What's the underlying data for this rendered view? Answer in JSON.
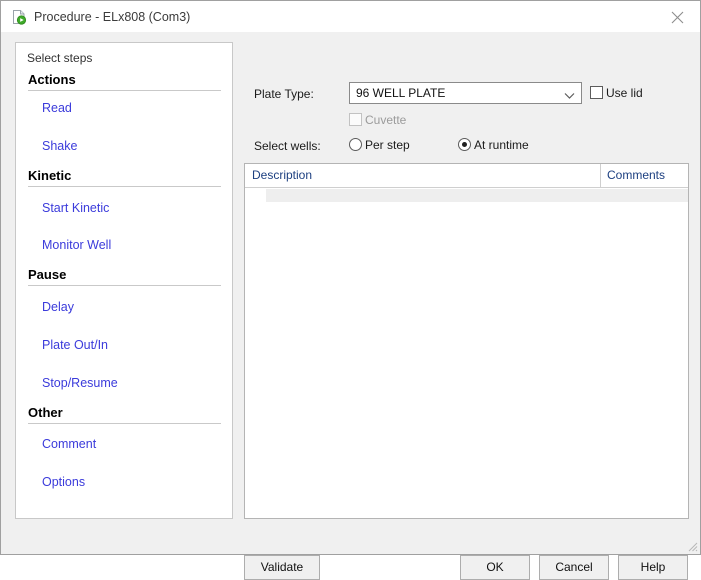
{
  "window": {
    "title": "Procedure - ELx808 (Com3)",
    "icon": "procedure-document-icon",
    "close_label": "✕"
  },
  "steps_panel": {
    "label": "Select steps",
    "groups": [
      {
        "title": "Actions",
        "items": [
          {
            "label": "Read"
          },
          {
            "label": "Shake"
          }
        ]
      },
      {
        "title": "Kinetic",
        "items": [
          {
            "label": "Start Kinetic"
          },
          {
            "label": "Monitor Well"
          }
        ]
      },
      {
        "title": "Pause",
        "items": [
          {
            "label": "Delay"
          },
          {
            "label": "Plate Out/In"
          },
          {
            "label": "Stop/Resume"
          }
        ]
      },
      {
        "title": "Other",
        "items": [
          {
            "label": "Comment"
          },
          {
            "label": "Options"
          }
        ]
      }
    ]
  },
  "settings": {
    "plate_type_label": "Plate Type:",
    "plate_type_value": "96 WELL PLATE",
    "use_lid_label": "Use lid",
    "use_lid_checked": false,
    "cuvette_label": "Cuvette",
    "cuvette_checked": false,
    "cuvette_disabled": true,
    "select_wells_label": "Select wells:",
    "per_step_label": "Per step",
    "per_step_selected": false,
    "at_runtime_label": "At runtime",
    "at_runtime_selected": true
  },
  "table": {
    "columns": [
      {
        "header": "Description"
      },
      {
        "header": "Comments"
      }
    ],
    "rows": []
  },
  "buttons": {
    "validate": "Validate",
    "ok": "OK",
    "cancel": "Cancel",
    "help": "Help"
  },
  "colors": {
    "link": "#3b3bdb",
    "header_text": "#1c3f80",
    "window_bg": "#f0f0f0"
  }
}
